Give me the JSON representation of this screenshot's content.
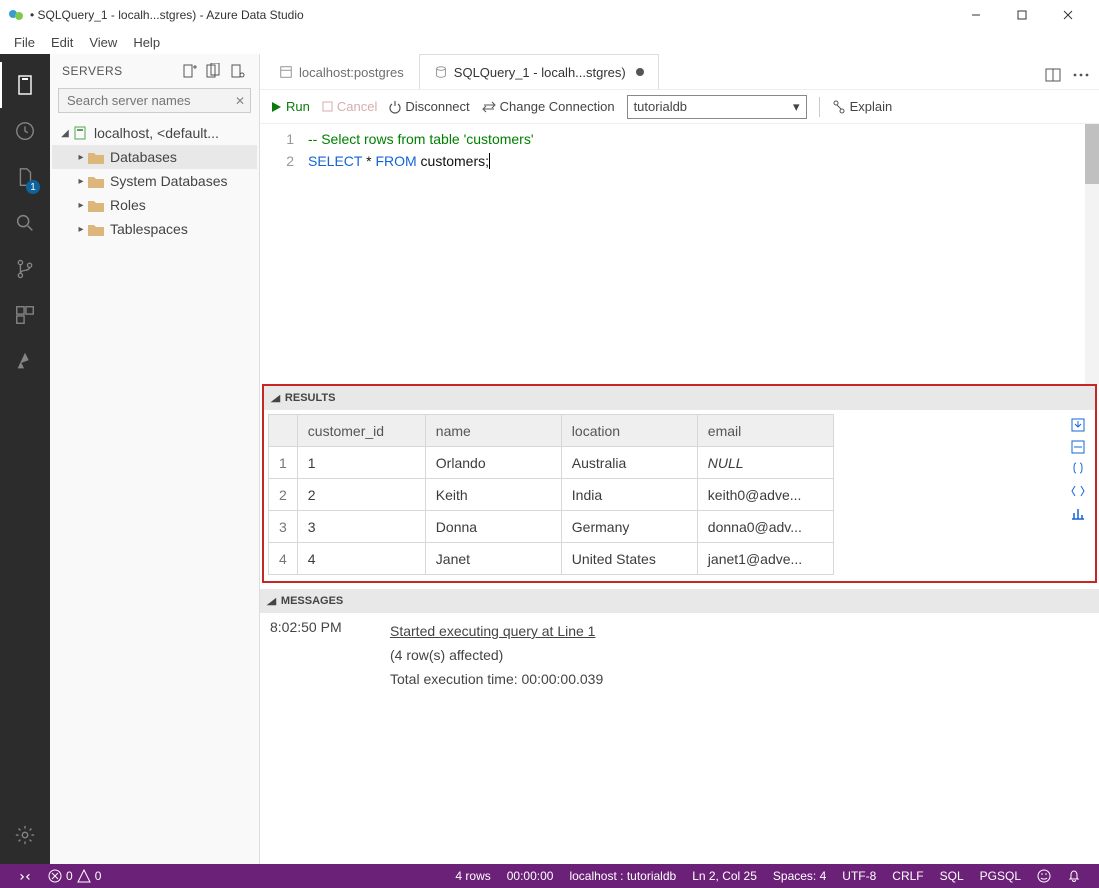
{
  "window": {
    "title": "• SQLQuery_1 - localh...stgres) - Azure Data Studio"
  },
  "menu": {
    "file": "File",
    "edit": "Edit",
    "view": "View",
    "help": "Help"
  },
  "activity": {
    "badge": "1"
  },
  "sidebar": {
    "header_label": "SERVERS",
    "search_placeholder": "Search server names",
    "server_label": "localhost, <default...",
    "items": [
      {
        "label": "Databases"
      },
      {
        "label": "System Databases"
      },
      {
        "label": "Roles"
      },
      {
        "label": "Tablespaces"
      }
    ]
  },
  "tabs": {
    "inactive_label": "localhost:postgres",
    "active_label": "SQLQuery_1 - localh...stgres)"
  },
  "toolbar": {
    "run": "Run",
    "cancel": "Cancel",
    "disconnect": "Disconnect",
    "change_conn": "Change Connection",
    "db_value": "tutorialdb",
    "explain": "Explain"
  },
  "editor": {
    "line1_no": "1",
    "line2_no": "2",
    "comment": "-- Select rows from table 'customers'",
    "kw_select": "SELECT",
    "star": " * ",
    "kw_from": "FROM",
    "ident": " customers;"
  },
  "results": {
    "header": "RESULTS",
    "cols": {
      "id": "customer_id",
      "name": "name",
      "loc": "location",
      "email": "email"
    },
    "rows": [
      {
        "n": "1",
        "id": "1",
        "name": "Orlando",
        "loc": "Australia",
        "email": "NULL",
        "null": true
      },
      {
        "n": "2",
        "id": "2",
        "name": "Keith",
        "loc": "India",
        "email": "keith0@adve..."
      },
      {
        "n": "3",
        "id": "3",
        "name": "Donna",
        "loc": "Germany",
        "email": "donna0@adv..."
      },
      {
        "n": "4",
        "id": "4",
        "name": "Janet",
        "loc": "United States",
        "email": "janet1@adve..."
      }
    ]
  },
  "messages": {
    "header": "MESSAGES",
    "time": "8:02:50 PM",
    "line1": "Started executing query at Line 1",
    "line2": "(4 row(s) affected)",
    "line3": "Total execution time: 00:00:00.039"
  },
  "status": {
    "err": "0",
    "warn": "0",
    "rows": "4 rows",
    "time": "00:00:00",
    "conn": "localhost : tutorialdb",
    "pos": "Ln 2, Col 25",
    "spaces": "Spaces: 4",
    "enc": "UTF-8",
    "eol": "CRLF",
    "lang": "SQL",
    "ext": "PGSQL"
  }
}
